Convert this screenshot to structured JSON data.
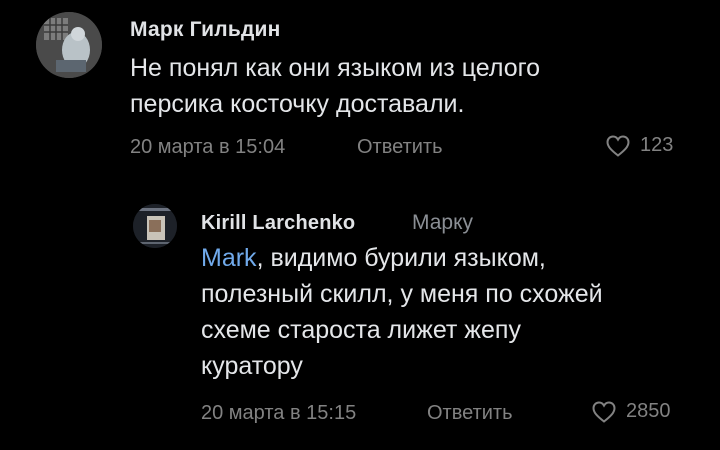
{
  "comments": [
    {
      "author": "Марк Гильдин",
      "lines": [
        "Не понял как они языком из целого",
        "персика косточку доставали."
      ],
      "date": "20 марта в 15:04",
      "reply_label": "Ответить",
      "likes": "123"
    }
  ],
  "reply": {
    "author": "Kirill Larchenko",
    "reply_to": "Марку",
    "mention": "Mark",
    "text_after_mention": ", видимо бурили языком,",
    "lines": [
      "полезный скилл, у меня по схожей",
      "схеме староста лижет жепу",
      "куратору"
    ],
    "date": "20 марта в 15:15",
    "reply_label": "Ответить",
    "likes": "2850"
  },
  "colors": {
    "background": "#000000",
    "text": "#e1e3e6",
    "secondary": "#828282",
    "mention": "#71aaeb"
  },
  "icons": {
    "like": "heart-outline-icon"
  }
}
